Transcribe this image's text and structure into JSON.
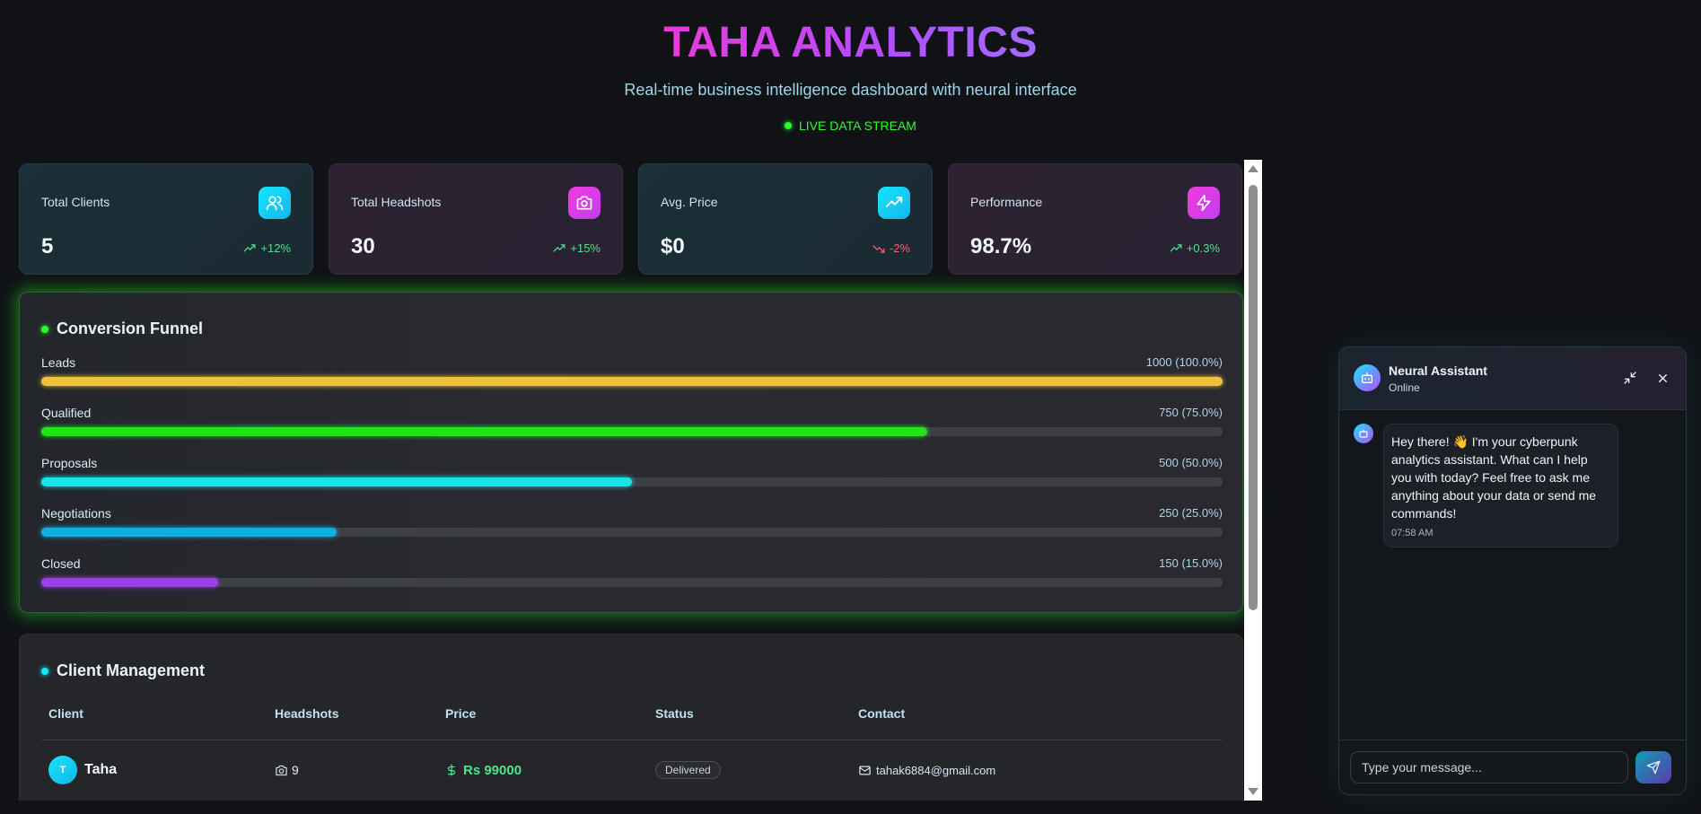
{
  "header": {
    "brand": "TAHA ANALYTICS",
    "subtitle": "Real-time business intelligence dashboard with neural interface",
    "live_label": "LIVE DATA STREAM"
  },
  "stats": [
    {
      "label": "Total Clients",
      "value": "5",
      "change": "+12%",
      "trend": "up",
      "icon": "users-icon"
    },
    {
      "label": "Total Headshots",
      "value": "30",
      "change": "+15%",
      "trend": "up",
      "icon": "camera-icon"
    },
    {
      "label": "Avg. Price",
      "value": "$0",
      "change": "-2%",
      "trend": "down",
      "icon": "trending-up-icon"
    },
    {
      "label": "Performance",
      "value": "98.7%",
      "change": "+0.3%",
      "trend": "up",
      "icon": "zap-icon"
    }
  ],
  "funnel": {
    "title": "Conversion Funnel",
    "stages": [
      {
        "label": "Leads",
        "value": "1000 (100.0%)",
        "percent": 100.0,
        "color": "#f0c040"
      },
      {
        "label": "Qualified",
        "value": "750 (75.0%)",
        "percent": 75.0,
        "color": "#22e31a"
      },
      {
        "label": "Proposals",
        "value": "500 (50.0%)",
        "percent": 50.0,
        "color": "#18e4ec"
      },
      {
        "label": "Negotiations",
        "value": "250 (25.0%)",
        "percent": 25.0,
        "color": "#12aee0"
      },
      {
        "label": "Closed",
        "value": "150 (15.0%)",
        "percent": 15.0,
        "color": "#9b3fe6"
      }
    ]
  },
  "clients": {
    "title": "Client Management",
    "columns": [
      "Client",
      "Headshots",
      "Price",
      "Status",
      "Contact"
    ],
    "rows": [
      {
        "initial": "T",
        "name": "Taha",
        "headshots": "9",
        "price": "Rs 99000",
        "status": "Delivered",
        "contact": "tahak6884@gmail.com"
      }
    ]
  },
  "chat": {
    "title": "Neural Assistant",
    "status": "Online",
    "messages": [
      {
        "text": "Hey there! 👋 I'm your cyberpunk analytics assistant. What can I help you with today? Feel free to ask me anything about your data or send me commands!",
        "time": "07:58 AM"
      }
    ],
    "input_placeholder": "Type your message..."
  },
  "colors": {
    "accent_cyan": "#18e4ff",
    "accent_magenta": "#e83ad8",
    "live_green": "#2aff2a",
    "positive": "#4ce38a",
    "negative": "#ff5b6e"
  }
}
